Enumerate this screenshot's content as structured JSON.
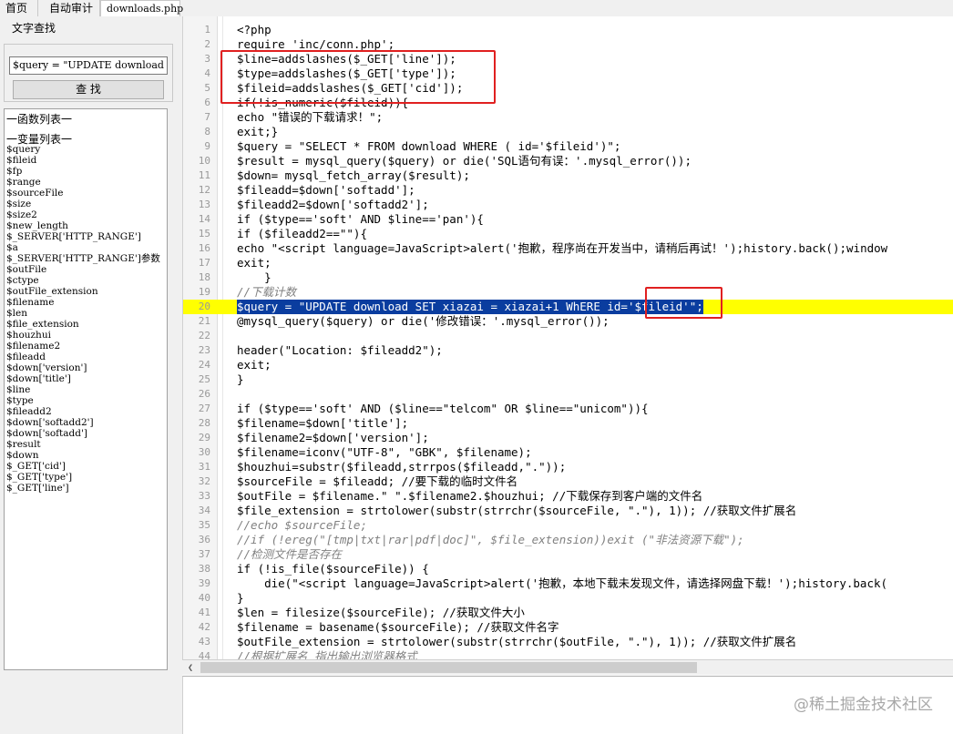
{
  "tabs": [
    {
      "label": "首页"
    },
    {
      "label": "自动审计"
    },
    {
      "label": "downloads.php"
    }
  ],
  "search": {
    "group_label": "文字查找",
    "value": "$query = \"UPDATE download SET",
    "button_label": "查 找"
  },
  "left_panel": {
    "function_list_heading": "一函数列表一",
    "variable_list_heading": "一变量列表一",
    "variables": [
      "$query",
      "$fileid",
      "$fp",
      "$range",
      "$sourceFile",
      "$size",
      "$size2",
      "$new_length",
      "$_SERVER['HTTP_RANGE']",
      "$a",
      "$_SERVER['HTTP_RANGE']参数",
      "$outFile",
      "$ctype",
      "$outFile_extension",
      "$filename",
      "$len",
      "$file_extension",
      "$houzhui",
      "$filename2",
      "$fileadd",
      "$down['version']",
      "$down['title']",
      "$line",
      "$type",
      "$fileadd2",
      "$down['softadd2']",
      "$down['softadd']",
      "$result",
      "$down",
      "$_GET['cid']",
      "$_GET['type']",
      "$_GET['line']"
    ]
  },
  "code": {
    "lines": [
      {
        "n": "1",
        "text": "<?php"
      },
      {
        "n": "2",
        "text": "require 'inc/conn.php';"
      },
      {
        "n": "3",
        "text": "$line=addslashes($_GET['line']);"
      },
      {
        "n": "4",
        "text": "$type=addslashes($_GET['type']);"
      },
      {
        "n": "5",
        "text": "$fileid=addslashes($_GET['cid']);"
      },
      {
        "n": "6",
        "text": "if(!is_numeric($fileid)){"
      },
      {
        "n": "7",
        "text": "echo \"错误的下载请求！\";"
      },
      {
        "n": "8",
        "text": "exit;}"
      },
      {
        "n": "9",
        "text": "$query = \"SELECT * FROM download WHERE ( id='$fileid')\";"
      },
      {
        "n": "10",
        "text": "$result = mysql_query($query) or die('SQL语句有误：'.mysql_error());"
      },
      {
        "n": "11",
        "text": "$down= mysql_fetch_array($result);"
      },
      {
        "n": "12",
        "text": "$fileadd=$down['softadd'];"
      },
      {
        "n": "13",
        "text": "$fileadd2=$down['softadd2'];"
      },
      {
        "n": "14",
        "text": "if ($type=='soft' AND $line=='pan'){"
      },
      {
        "n": "15",
        "text": "if ($fileadd2==\"\"){"
      },
      {
        "n": "16",
        "text": "echo \"<script language=JavaScript>alert('抱歉，程序尚在开发当中，请稍后再试！');history.back();window"
      },
      {
        "n": "17",
        "text": "exit;"
      },
      {
        "n": "18",
        "text": "    }"
      },
      {
        "n": "19",
        "text": "//下载计数"
      },
      {
        "n": "20",
        "text": "$query = \"UPDATE download SET xiazai = xiazai+1 WhERE id='$fileid'\";"
      },
      {
        "n": "21",
        "text": "@mysql_query($query) or die('修改错误：'.mysql_error());"
      },
      {
        "n": "22",
        "text": ""
      },
      {
        "n": "23",
        "text": "header(\"Location: $fileadd2\");"
      },
      {
        "n": "24",
        "text": "exit;"
      },
      {
        "n": "25",
        "text": "}"
      },
      {
        "n": "26",
        "text": ""
      },
      {
        "n": "27",
        "text": "if ($type=='soft' AND ($line==\"telcom\" OR $line==\"unicom\")){"
      },
      {
        "n": "28",
        "text": "$filename=$down['title'];"
      },
      {
        "n": "29",
        "text": "$filename2=$down['version'];"
      },
      {
        "n": "30",
        "text": "$filename=iconv(\"UTF-8\", \"GBK\", $filename);"
      },
      {
        "n": "31",
        "text": "$houzhui=substr($fileadd,strrpos($fileadd,\".\"));"
      },
      {
        "n": "32",
        "text": "$sourceFile = $fileadd; //要下载的临时文件名"
      },
      {
        "n": "33",
        "text": "$outFile = $filename.\" \".$filename2.$houzhui; //下载保存到客户端的文件名"
      },
      {
        "n": "34",
        "text": "$file_extension = strtolower(substr(strrchr($sourceFile, \".\"), 1)); //获取文件扩展名"
      },
      {
        "n": "35",
        "text": "//echo $sourceFile;"
      },
      {
        "n": "36",
        "text": "//if (!ereg(\"[tmp|txt|rar|pdf|doc]\", $file_extension))exit (\"非法资源下载\");"
      },
      {
        "n": "37",
        "text": "//检测文件是否存在"
      },
      {
        "n": "38",
        "text": "if (!is_file($sourceFile)) {"
      },
      {
        "n": "39",
        "text": "    die(\"<script language=JavaScript>alert('抱歉，本地下载未发现文件，请选择网盘下载！');history.back("
      },
      {
        "n": "40",
        "text": "}"
      },
      {
        "n": "41",
        "text": "$len = filesize($sourceFile); //获取文件大小"
      },
      {
        "n": "42",
        "text": "$filename = basename($sourceFile); //获取文件名字"
      },
      {
        "n": "43",
        "text": "$outFile_extension = strtolower(substr(strrchr($outFile, \".\"), 1)); //获取文件扩展名"
      },
      {
        "n": "44",
        "text": "//根据扩展名 指出输出浏览器格式"
      }
    ]
  },
  "watermark": "@稀土掘金技术社区",
  "colors": {
    "highlight_line": "#ffff00",
    "selection": "#0a3d9f",
    "annotation_box": "#e02020"
  }
}
